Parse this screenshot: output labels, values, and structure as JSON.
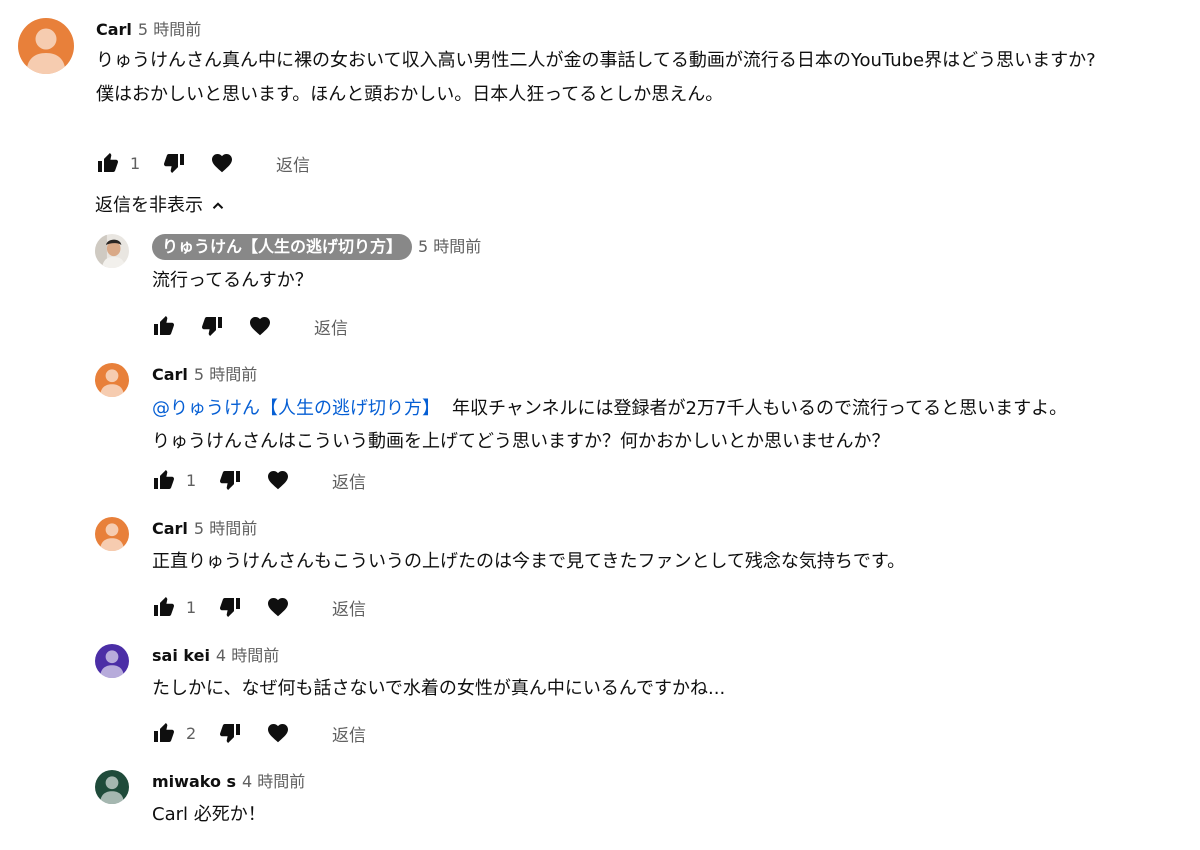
{
  "colors": {
    "orange_avatar": "#e8803a",
    "purple_avatar": "#4b2ea6",
    "green_avatar": "#1f4b3a",
    "mention": "#065fd4",
    "secondary_text": "#606060"
  },
  "top_comment": {
    "author": "Carl",
    "time": "5 時間前",
    "lines": [
      "りゅうけんさん真ん中に裸の女おいて収入高い男性二人が金の事話してる動画が流行る日本のYouTube界はどう思いますか?",
      "僕はおかしいと思います。ほんと頭おかしい。日本人狂ってるとしか思えん。"
    ],
    "like_count": "1",
    "reply_label": "返信"
  },
  "hide_replies_label": "返信を非表示",
  "replies": [
    {
      "author": "りゅうけん【人生の逃げ切り方】",
      "time": "5 時間前",
      "lines": [
        "流行ってるんすか？"
      ],
      "like_count": "",
      "reply_label": "返信"
    },
    {
      "author": "Carl",
      "time": "5 時間前",
      "mention": "@りゅうけん【人生の逃げ切り方】",
      "lines": [
        "年収チャンネルには登録者が2万7千人もいるので流行ってると思いますよ。",
        "りゅうけんさんはこういう動画を上げてどう思いますか？何かおかしいとか思いませんか？"
      ],
      "like_count": "1",
      "reply_label": "返信"
    },
    {
      "author": "Carl",
      "time": "5 時間前",
      "lines": [
        "正直りゅうけんさんもこういうの上げたのは今まで見てきたファンとして残念な気持ちです。"
      ],
      "like_count": "1",
      "reply_label": "返信"
    },
    {
      "author": "sai kei",
      "time": "4 時間前",
      "lines": [
        "たしかに、なぜ何も話さないで水着の女性が真ん中にいるんですかね..."
      ],
      "like_count": "2",
      "reply_label": "返信"
    },
    {
      "author": "miwako s",
      "time": "4 時間前",
      "lines": [
        "Carl 必死か！"
      ]
    }
  ]
}
